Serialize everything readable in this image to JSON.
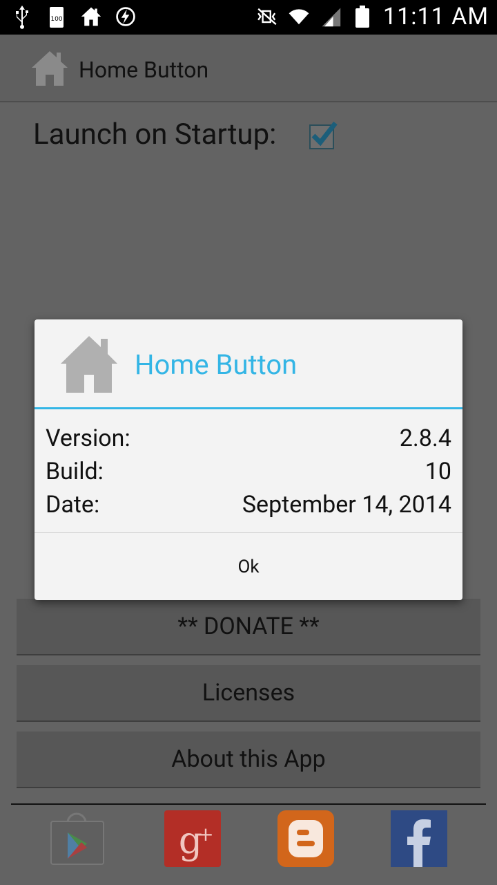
{
  "status_bar": {
    "time": "11:11 AM",
    "battery_label": "100"
  },
  "action_bar": {
    "title": "Home Button"
  },
  "settings": {
    "launch_on_startup_label": "Launch on Startup:",
    "launch_on_startup_checked": true
  },
  "buttons": {
    "donate": "** DONATE **",
    "licenses": "Licenses",
    "about": "About this App"
  },
  "social": [
    "google-play-icon",
    "google-plus-icon",
    "blogger-icon",
    "facebook-icon"
  ],
  "dialog": {
    "title": "Home Button",
    "rows": [
      {
        "label": "Version:",
        "value": "2.8.4"
      },
      {
        "label": "Build:",
        "value": "10"
      },
      {
        "label": "Date:",
        "value": "September 14, 2014"
      }
    ],
    "ok_label": "Ok",
    "accent_color": "#33b5e5"
  }
}
